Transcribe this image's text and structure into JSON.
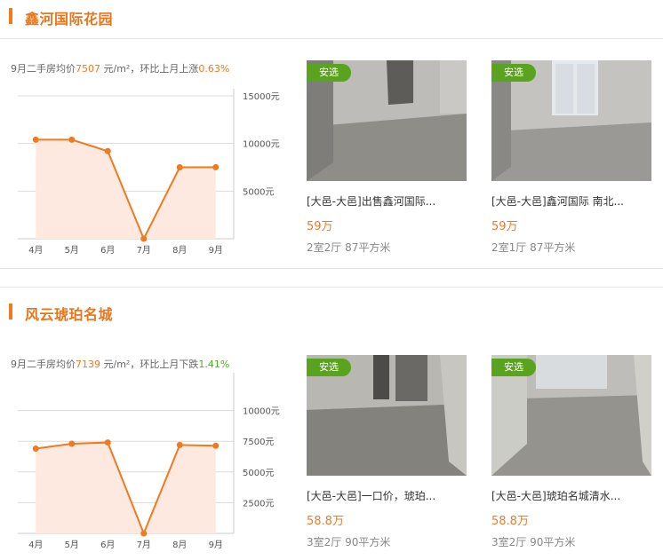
{
  "sections": [
    {
      "title": "鑫河国际花园",
      "summary": {
        "prefix": "9月二手房均价",
        "price": "7507",
        "unit": " 元/m²，环比上月上涨",
        "change": "0.63%"
      },
      "chart_data": {
        "type": "area",
        "categories": [
          "4月",
          "5月",
          "6月",
          "7月",
          "8月",
          "9月"
        ],
        "values": [
          10400,
          10400,
          9200,
          0,
          7500,
          7507
        ],
        "ylim": [
          0,
          15000
        ],
        "yticks": [
          "15000元",
          "10000元",
          "5000元"
        ],
        "ytick_values": [
          15000,
          10000,
          5000
        ],
        "grid": true
      },
      "listings": [
        {
          "tag": "安选",
          "title": "[大邑-大邑]出售鑫河国际...",
          "price": "59万",
          "spec": "2室2厅 87平方米"
        },
        {
          "tag": "安选",
          "title": "[大邑-大邑]鑫河国际 南北...",
          "price": "59万",
          "spec": "2室1厅 87平方米"
        }
      ]
    },
    {
      "title": "风云琥珀名城",
      "summary": {
        "prefix": "9月二手房均价",
        "price": "7139",
        "unit": " 元/m²，环比上月下跌",
        "change": "1.41%"
      },
      "chart_data": {
        "type": "area",
        "categories": [
          "4月",
          "5月",
          "6月",
          "7月",
          "8月",
          "9月"
        ],
        "values": [
          6900,
          7300,
          7400,
          0,
          7200,
          7139
        ],
        "ylim": [
          0,
          12500
        ],
        "yticks": [
          "10000元",
          "7500元",
          "5000元",
          "2500元"
        ],
        "ytick_values": [
          10000,
          7500,
          5000,
          2500
        ],
        "grid": true
      },
      "listings": [
        {
          "tag": "安选",
          "title": "[大邑-大邑]一口价，琥珀...",
          "price": "58.8万",
          "spec": "3室2厅 90平方米"
        },
        {
          "tag": "安选",
          "title": "[大邑-大邑]琥珀名城清水...",
          "price": "58.8万",
          "spec": "3室2厅 90平方米"
        }
      ]
    }
  ],
  "colors": {
    "accent": "#f07a1e",
    "tag": "#5aa31e",
    "area_fill": "#fde9df",
    "down": "#4caf1a"
  }
}
